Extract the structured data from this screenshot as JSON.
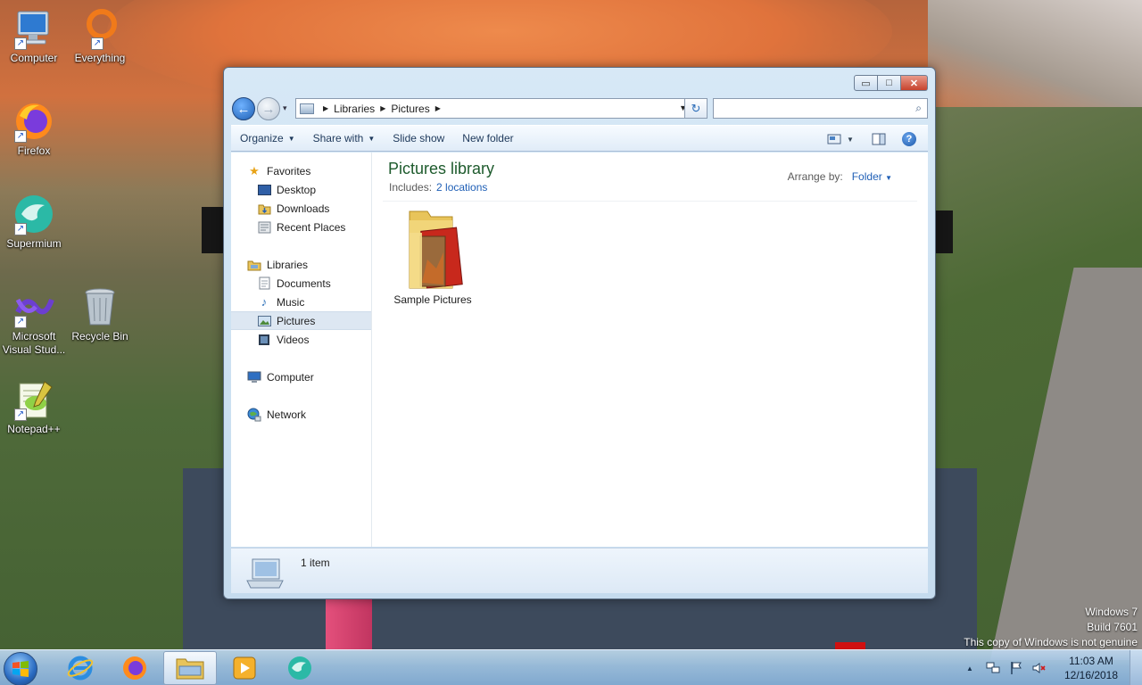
{
  "desktop": {
    "icons": [
      {
        "label": "Computer",
        "icon": "computer-icon"
      },
      {
        "label": "Everything",
        "icon": "everything-icon"
      },
      {
        "label": "Firefox",
        "icon": "firefox-icon"
      },
      {
        "label": "Supermium",
        "icon": "supermium-icon"
      },
      {
        "label_line1": "Microsoft",
        "label_line2": "Visual Stud...",
        "icon": "visual-studio-icon"
      },
      {
        "label": "Recycle Bin",
        "icon": "recycle-bin-icon"
      },
      {
        "label": "Notepad++",
        "icon": "notepadpp-icon"
      }
    ],
    "shortcut_arrow": "↗"
  },
  "window": {
    "caption": {
      "min": "▭",
      "max": "□",
      "close": "✕"
    },
    "nav": {
      "back": "←",
      "forward": "→",
      "history": "▾"
    },
    "address": {
      "crumbs": [
        "Libraries",
        "Pictures"
      ],
      "separator": "▶",
      "dropdown": "▼"
    },
    "refresh": "↻",
    "search": {
      "value": "",
      "placeholder": "",
      "icon": "⌕"
    },
    "toolbar": {
      "organize": "Organize",
      "share_with": "Share with",
      "slide_show": "Slide show",
      "new_folder": "New folder",
      "dropdown_arrow": "▼",
      "help": "?"
    },
    "navpane": {
      "favorites": "Favorites",
      "desktop": "Desktop",
      "downloads": "Downloads",
      "recent_places": "Recent Places",
      "libraries": "Libraries",
      "documents": "Documents",
      "music": "Music",
      "pictures": "Pictures",
      "videos": "Videos",
      "computer": "Computer",
      "network": "Network"
    },
    "main": {
      "title": "Pictures library",
      "includes_label": "Includes:",
      "includes_link": "2 locations",
      "arrange_label": "Arrange by:",
      "arrange_value": "Folder",
      "arrange_arrow": "▼",
      "items": [
        {
          "label": "Sample Pictures"
        }
      ]
    },
    "details": {
      "count": "1 item"
    }
  },
  "watermark": {
    "line1": "Windows 7",
    "line2": "Build 7601",
    "line3": "This copy of Windows is not genuine"
  },
  "taskbar": {
    "tray_arrow": "▲",
    "clock_time": "11:03 AM",
    "clock_date": "12/16/2018"
  }
}
